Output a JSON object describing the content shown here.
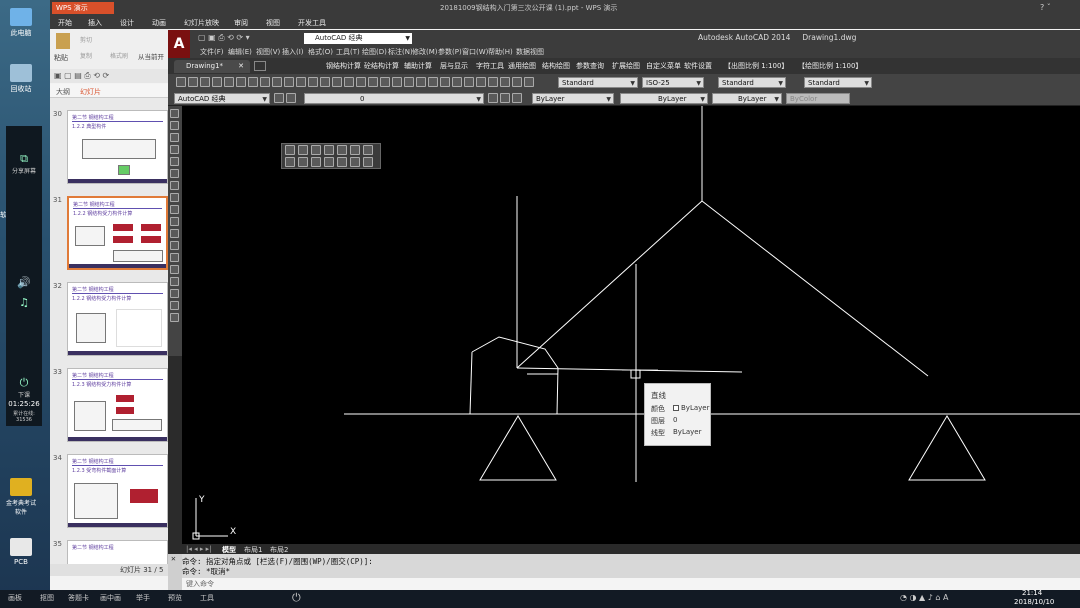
{
  "desktop": {
    "icons": [
      {
        "label": "此电脑"
      },
      {
        "label": "回收站"
      },
      {
        "label": "PCB"
      }
    ],
    "side_panel": {
      "share_label": "分享屏幕",
      "down_label": "下课",
      "timer": "01:25:26",
      "stats": "累计在线:\n31536",
      "network": "网络信号"
    },
    "exam_icon_label": "金考典考试软件",
    "soft_label": "软"
  },
  "wps": {
    "app_name": "WPS 演示",
    "title": "20181009钢结构入门第三次公开课 (1).ppt - WPS 演示",
    "menu": [
      "开始",
      "插入",
      "设计",
      "动画",
      "幻灯片放映",
      "审阅",
      "视图",
      "开发工具"
    ],
    "ribbon": {
      "paste": "粘贴",
      "cut": "剪切",
      "copy": "复制",
      "format": "格式刷",
      "from_start": "从当前开"
    },
    "tabs": [
      "大纲",
      "幻灯片"
    ],
    "slides": [
      {
        "num": "30",
        "title": "第二节 钢结构工程",
        "sub": "1.2.2 典型构件"
      },
      {
        "num": "31",
        "title": "第二节 钢结构工程",
        "sub": "1.2.2 钢结构受力构件计算"
      },
      {
        "num": "32",
        "title": "第二节 钢结构工程",
        "sub": "1.2.2 钢结构受力构件计算"
      },
      {
        "num": "33",
        "title": "第二节 钢结构工程",
        "sub": "1.2.3 钢结构受力构件计算"
      },
      {
        "num": "34",
        "title": "第二节 钢结构工程",
        "sub": "1.2.3 受弯构件截面计算"
      },
      {
        "num": "35",
        "title": "第二节 钢结构工程",
        "sub": ""
      }
    ],
    "status": "幻灯片 31 / 5"
  },
  "acad": {
    "workspace": "AutoCAD 经典",
    "app_title": "Autodesk AutoCAD 2014     Drawing1.dwg",
    "menu": [
      "文件(F)",
      "编辑(E)",
      "视图(V)",
      "插入(I)",
      "格式(O)",
      "工具(T)",
      "绘图(D)",
      "标注(N)",
      "修改(M)",
      "参数(P)",
      "窗口(W)",
      "帮助(H)",
      "数据视图"
    ],
    "drawing_tab": "Drawing1*",
    "plugin_menu": [
      "钢结构计算",
      "砼结构计算",
      "辅助计算",
      "层与显示",
      "字符工具",
      "通用绘图",
      "结构绘图",
      "参数查询",
      "扩展绘图",
      "自定义菜单",
      "软件设置",
      "【出图比例 1:100】",
      "【绘图比例 1:100】"
    ],
    "styles": {
      "text_style": "Standard",
      "dim_style": "ISO-25",
      "table_style": "Standard",
      "mleader_style": "Standard"
    },
    "workspace_combo": "AutoCAD 经典",
    "layer": "0",
    "color": "ByLayer",
    "linetype": "ByLayer",
    "lineweight": "ByLayer",
    "plot_style": "ByColor",
    "layout_tabs": [
      "模型",
      "布局1",
      "布局2"
    ],
    "command_lines": [
      "命令: 指定对角点或 [栏选(F)/圈围(WP)/圈交(CP)]:",
      "命令: *取消*"
    ],
    "command_prompt": "键入命令",
    "ucs": {
      "x": "X",
      "y": "Y"
    },
    "tooltip": {
      "title": "直线",
      "rows": [
        {
          "label": "颜色",
          "value": "ByLayer"
        },
        {
          "label": "图层",
          "value": "0"
        },
        {
          "label": "线型",
          "value": "ByLayer"
        }
      ]
    }
  },
  "taskbar": {
    "items": [
      "画板",
      "抠图",
      "答题卡",
      "画中画",
      "举手",
      "预览",
      "工具"
    ],
    "time": "21:14",
    "date": "2018/10/10"
  }
}
